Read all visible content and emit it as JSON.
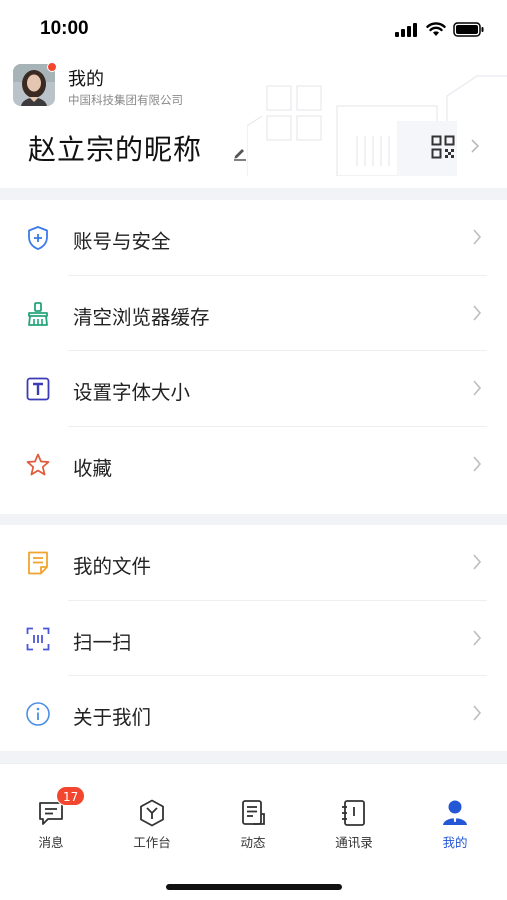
{
  "status_bar": {
    "time": "10:00"
  },
  "header": {
    "title": "我的",
    "company": "中国科技集团有限公司",
    "nickname": "赵立宗的昵称"
  },
  "menu_group_1": [
    {
      "label": "账号与安全",
      "icon": "shield-plus-icon",
      "color": "#3b7be8"
    },
    {
      "label": "清空浏览器缓存",
      "icon": "broom-icon",
      "color": "#24a57a"
    },
    {
      "label": "设置字体大小",
      "icon": "text-size-icon",
      "color": "#3b3bb5"
    },
    {
      "label": "收藏",
      "icon": "star-icon",
      "color": "#e05a3a"
    }
  ],
  "menu_group_2": [
    {
      "label": "我的文件",
      "icon": "document-icon",
      "color": "#f0a530"
    },
    {
      "label": "扫一扫",
      "icon": "scan-icon",
      "color": "#4957d8"
    },
    {
      "label": "关于我们",
      "icon": "info-icon",
      "color": "#4a8fe6"
    }
  ],
  "tabbar": {
    "tabs": [
      {
        "label": "消息",
        "icon": "message-icon",
        "badge": "17"
      },
      {
        "label": "工作台",
        "icon": "workbench-icon"
      },
      {
        "label": "动态",
        "icon": "feed-icon"
      },
      {
        "label": "通讯录",
        "icon": "contacts-icon"
      },
      {
        "label": "我的",
        "icon": "profile-icon",
        "active": true
      }
    ],
    "active_color": "#2457d6"
  }
}
